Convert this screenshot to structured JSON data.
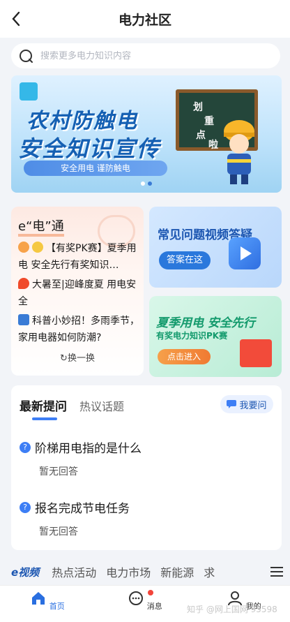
{
  "header": {
    "title": "电力社区"
  },
  "search": {
    "placeholder": "搜索更多电力知识内容"
  },
  "banner": {
    "line1": "农村防触电",
    "line2": "安全知识宣传",
    "tagline": "安全用电 谨防触电",
    "board_text": [
      "划",
      "重",
      "点",
      "啦"
    ]
  },
  "ecard": {
    "title": "e“电”通",
    "items": [
      "【有奖PK赛】夏季用电 安全先行有奖知识…",
      "大暑至|迎峰度夏 用电安全",
      "科普小妙招！多雨季节，家用电器如何防潮?"
    ],
    "refresh": "换一换"
  },
  "faq": {
    "title": "常见问题视频答疑",
    "button": "答案在这"
  },
  "pk": {
    "title": "夏季用电 安全先行",
    "subtitle": "有奖电力知识PK赛",
    "button": "点击进入"
  },
  "qa": {
    "tabs": [
      "最新提问",
      "热议话题"
    ],
    "ask_label": "我要问",
    "questions": [
      {
        "title": "阶梯用电指的是什么",
        "status": "暂无回答"
      },
      {
        "title": "报名完成节电任务",
        "status": "暂无回答"
      }
    ]
  },
  "channels": {
    "brand": "e视频",
    "items": [
      "热点活动",
      "电力市场",
      "新能源",
      "求"
    ]
  },
  "bottom_nav": {
    "items": [
      "首页",
      "消息",
      "我的"
    ]
  },
  "watermark": "知乎 @网上国网 95598",
  "colors": {
    "primary": "#2a6fe0",
    "accent_green": "#139a6c",
    "accent_orange": "#f07a32"
  }
}
